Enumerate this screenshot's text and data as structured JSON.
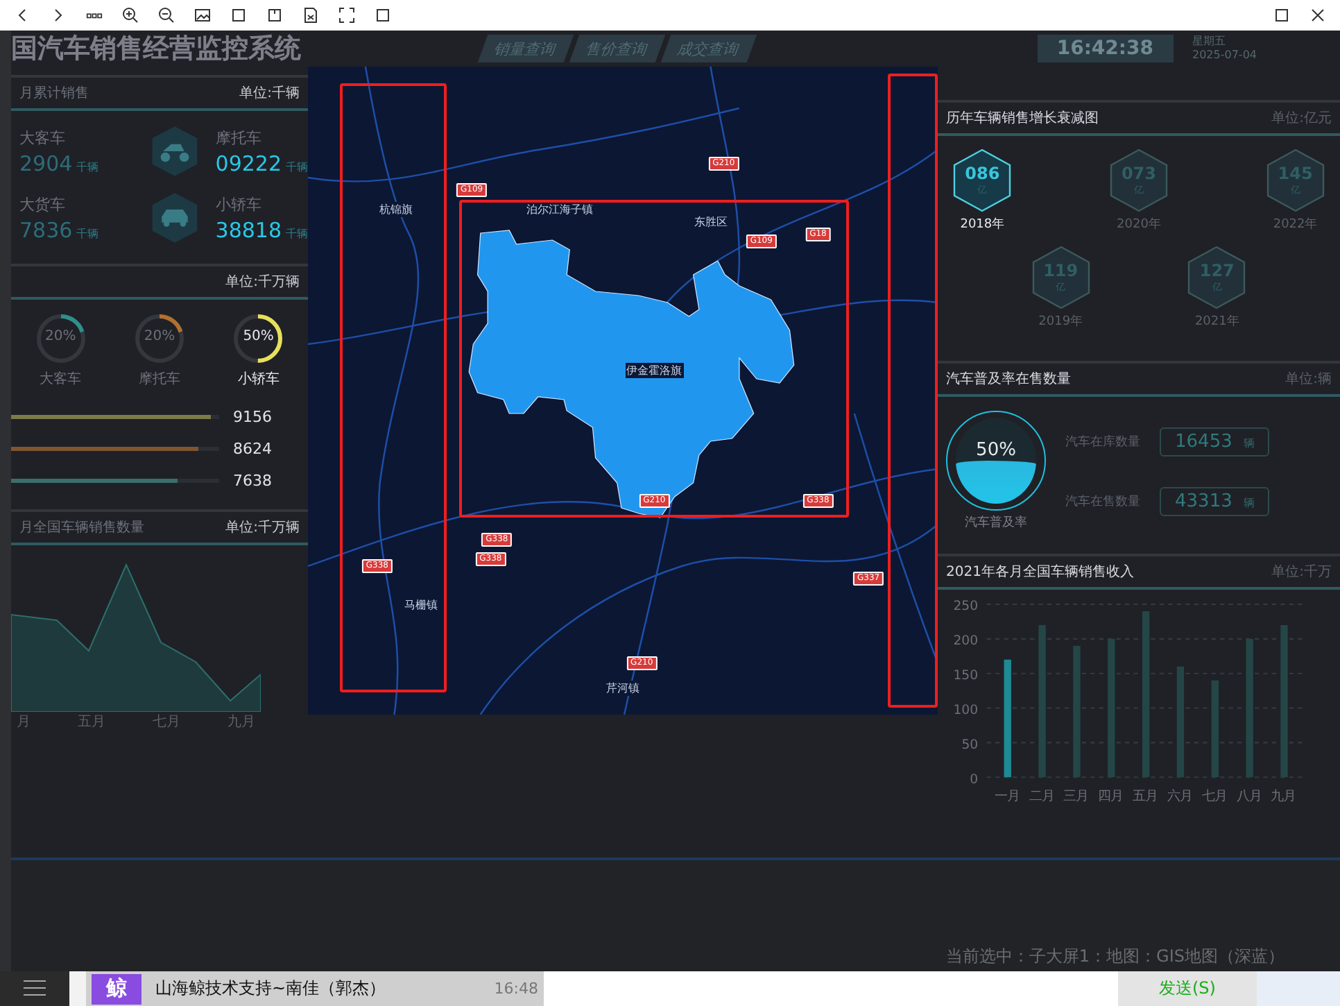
{
  "dashboard": {
    "title": "国汽车销售经营监控系统",
    "nav_tabs": [
      {
        "label": "销量查询",
        "selected": false
      },
      {
        "label": "售价查询",
        "selected": false
      },
      {
        "label": "成交查询",
        "selected": false
      }
    ],
    "clock": {
      "time": "16:42:38",
      "weekday": "星期五",
      "date": "2025-07-04"
    },
    "sales": {
      "title": "月累计销售",
      "unit": "单位:千辆",
      "items": [
        {
          "name": "大客车",
          "value": "2904",
          "unit": "千辆",
          "kind": "plain"
        },
        {
          "name": "摩托车",
          "value": "09222",
          "unit": "千辆",
          "kind": "motorcycle"
        },
        {
          "name": "大货车",
          "value": "7836",
          "unit": "千辆",
          "kind": "plain"
        },
        {
          "name": "小轿车",
          "value": "38818",
          "unit": "千辆",
          "kind": "car"
        }
      ]
    },
    "ratio": {
      "unit": "单位:千万辆",
      "rings": [
        {
          "text": "20%",
          "label": "大客车",
          "level": 0.2,
          "color": "#2f8f8a"
        },
        {
          "text": "20%",
          "label": "摩托车",
          "level": 0.2,
          "color": "#b2702f"
        },
        {
          "text": "50%",
          "label": "小轿车",
          "level": 0.5,
          "color": "#e8e05a"
        }
      ],
      "bars": [
        {
          "value": "9156",
          "level": 0.96,
          "color": "#7c7a45"
        },
        {
          "value": "8624",
          "level": 0.9,
          "color": "#7f5431"
        },
        {
          "value": "7638",
          "level": 0.8,
          "color": "#3c6e6b"
        }
      ]
    },
    "monthly": {
      "title": "月全国车辆销售数量",
      "unit": "单位:千万辆",
      "x_labels": [
        "月",
        "五月",
        "七月",
        "九月"
      ]
    },
    "map": {
      "labels": [
        "杭锦旗",
        "泊尔江海子镇",
        "东胜区",
        "伊金霍洛旗",
        "马栅镇",
        "芹河镇"
      ],
      "road_badges": [
        "G109",
        "G210",
        "G109",
        "G18",
        "G210",
        "G338",
        "G338",
        "G338",
        "G337",
        "G210",
        "G338"
      ]
    },
    "growth": {
      "title": "历年车辆销售增长衰减图",
      "unit": "单位:亿元",
      "items": [
        {
          "value": "086",
          "unit": "亿",
          "year": "2018年",
          "selected": true
        },
        {
          "value": "119",
          "unit": "亿",
          "year": "2019年",
          "selected": false
        },
        {
          "value": "073",
          "unit": "亿",
          "year": "2020年",
          "selected": false
        },
        {
          "value": "127",
          "unit": "亿",
          "year": "2021年",
          "selected": false
        },
        {
          "value": "145",
          "unit": "亿",
          "year": "2022年",
          "selected": false
        }
      ]
    },
    "popularity": {
      "title": "汽车普及率在售数量",
      "unit": "单位:辆",
      "gauge": {
        "text": "50%",
        "label": "汽车普及率",
        "level": 0.5
      },
      "stats": [
        {
          "label": "汽车在库数量",
          "value": "16453",
          "unit": "辆"
        },
        {
          "label": "汽车在售数量",
          "value": "43313",
          "unit": "辆"
        }
      ]
    },
    "revenue": {
      "title": "2021年各月全国车辆销售收入",
      "unit": "单位:千万",
      "chart_data": {
        "type": "bar",
        "categories": [
          "一月",
          "二月",
          "三月",
          "四月",
          "五月",
          "六月",
          "七月",
          "八月",
          "九月"
        ],
        "values": [
          170,
          220,
          190,
          200,
          240,
          160,
          140,
          200,
          220
        ],
        "ylim": [
          0,
          250
        ],
        "yticks": [
          0,
          50,
          100,
          150,
          200,
          250
        ],
        "grid": true
      }
    }
  },
  "status_text": "当前选中：子大屏1：地图：GIS地图（深蓝）",
  "taskbar": {
    "chat": {
      "avatar": "鲸",
      "name": "山海鲸技术支持~南佳（郭杰）",
      "time": "16:48"
    },
    "send_button": "发送(S)"
  }
}
